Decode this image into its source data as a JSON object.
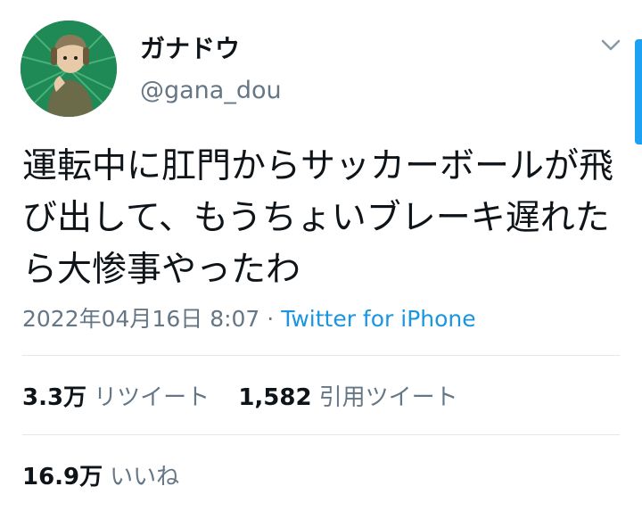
{
  "user": {
    "display_name": "ガナドウ",
    "handle": "@gana_dou"
  },
  "tweet": {
    "text": "運転中に肛門からサッカーボールが飛び出して、もうちょいブレーキ遅れたら大惨事やったわ",
    "date": "2022年04月16日 8:07",
    "separator": " · ",
    "source": "Twitter for iPhone"
  },
  "stats": {
    "retweets": {
      "count": "3.3万",
      "label": "リツイート"
    },
    "quotes": {
      "count": "1,582",
      "label": "引用ツイート"
    },
    "likes": {
      "count": "16.9万",
      "label": "いいね"
    }
  },
  "icons": {
    "menu": "chevron-down-icon"
  },
  "colors": {
    "link": "#1b95e0",
    "secondary_text": "#657786",
    "divider": "#e1e8ed",
    "scrollbar": "#1da1f2"
  }
}
